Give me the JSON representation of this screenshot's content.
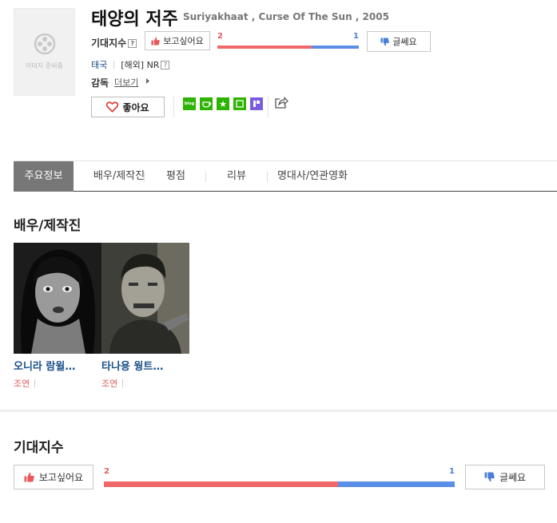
{
  "movie": {
    "title": "태양의 저주",
    "subtitle": "Suriyakhaat , Curse Of The Sun , 2005",
    "poster_placeholder": "이미지 준비중",
    "expect_label": "기대지수",
    "want_label": "보고싶어요",
    "meh_label": "글쎄요",
    "want_count": "2",
    "meh_count": "1",
    "want_ratio": 0.667,
    "country": "태국",
    "rating": "[해외] NR",
    "director_label": "감독",
    "more_label": "더보기",
    "like_label": "좋아요",
    "help_mark": "?"
  },
  "share": [
    {
      "name": "blog",
      "text": "blog",
      "color": "#2db400"
    },
    {
      "name": "cafe",
      "text": "",
      "color": "#2db400"
    },
    {
      "name": "bookmark",
      "text": "★",
      "color": "#2db400"
    },
    {
      "name": "memo",
      "text": "",
      "color": "#2db400"
    },
    {
      "name": "band",
      "text": "",
      "color": "#7b5ce0"
    }
  ],
  "tabs": [
    "주요정보",
    "배우/제작진",
    "평점",
    "리뷰",
    "명대사/연관영화"
  ],
  "cast_section": {
    "title": "배우/제작진",
    "actors": [
      {
        "name": "오니라 람윌…",
        "role": "조연"
      },
      {
        "name": "타나용 웡트…",
        "role": "조연"
      }
    ]
  },
  "expect_section": {
    "title": "기대지수",
    "want_label": "보고싶어요",
    "meh_label": "글쎄요",
    "want_count": "2",
    "meh_count": "1",
    "want_ratio": 0.667
  },
  "colors": {
    "red": "#f1686a",
    "blue": "#5b8ee6",
    "link": "#1a4f8a"
  }
}
